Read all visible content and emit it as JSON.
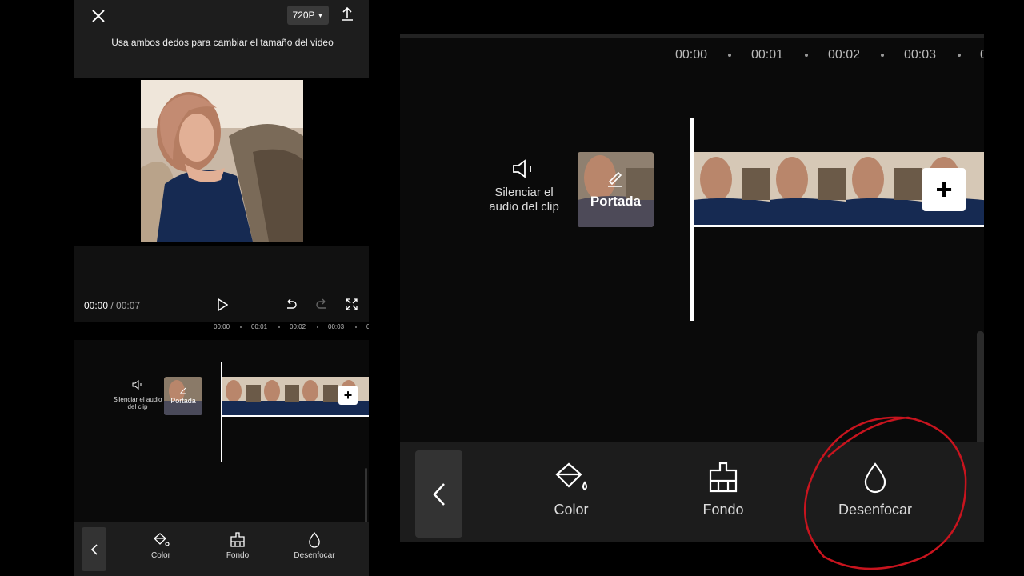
{
  "header": {
    "resolution_label": "720P",
    "resize_hint": "Usa ambos dedos para cambiar el tamaño del video"
  },
  "player": {
    "current_time": "00:00",
    "separator": " / ",
    "total_time": "00:07"
  },
  "timeline": {
    "ruler_ticks_small": [
      "00:00",
      "00:01",
      "00:02",
      "00:03",
      "0"
    ],
    "ruler_ticks_large": [
      "00:00",
      "00:01",
      "00:02",
      "00:03",
      "0"
    ],
    "mute_label": "Silenciar el audio del clip",
    "cover_label": "Portada",
    "add_label": "+"
  },
  "toolbar": {
    "items": [
      {
        "label": "Color",
        "icon": "paint-bucket-icon"
      },
      {
        "label": "Fondo",
        "icon": "brush-icon"
      },
      {
        "label": "Desenfocar",
        "icon": "droplet-icon"
      }
    ]
  },
  "colors": {
    "panel": "#1d1d1d",
    "annotation": "#c8141e"
  }
}
